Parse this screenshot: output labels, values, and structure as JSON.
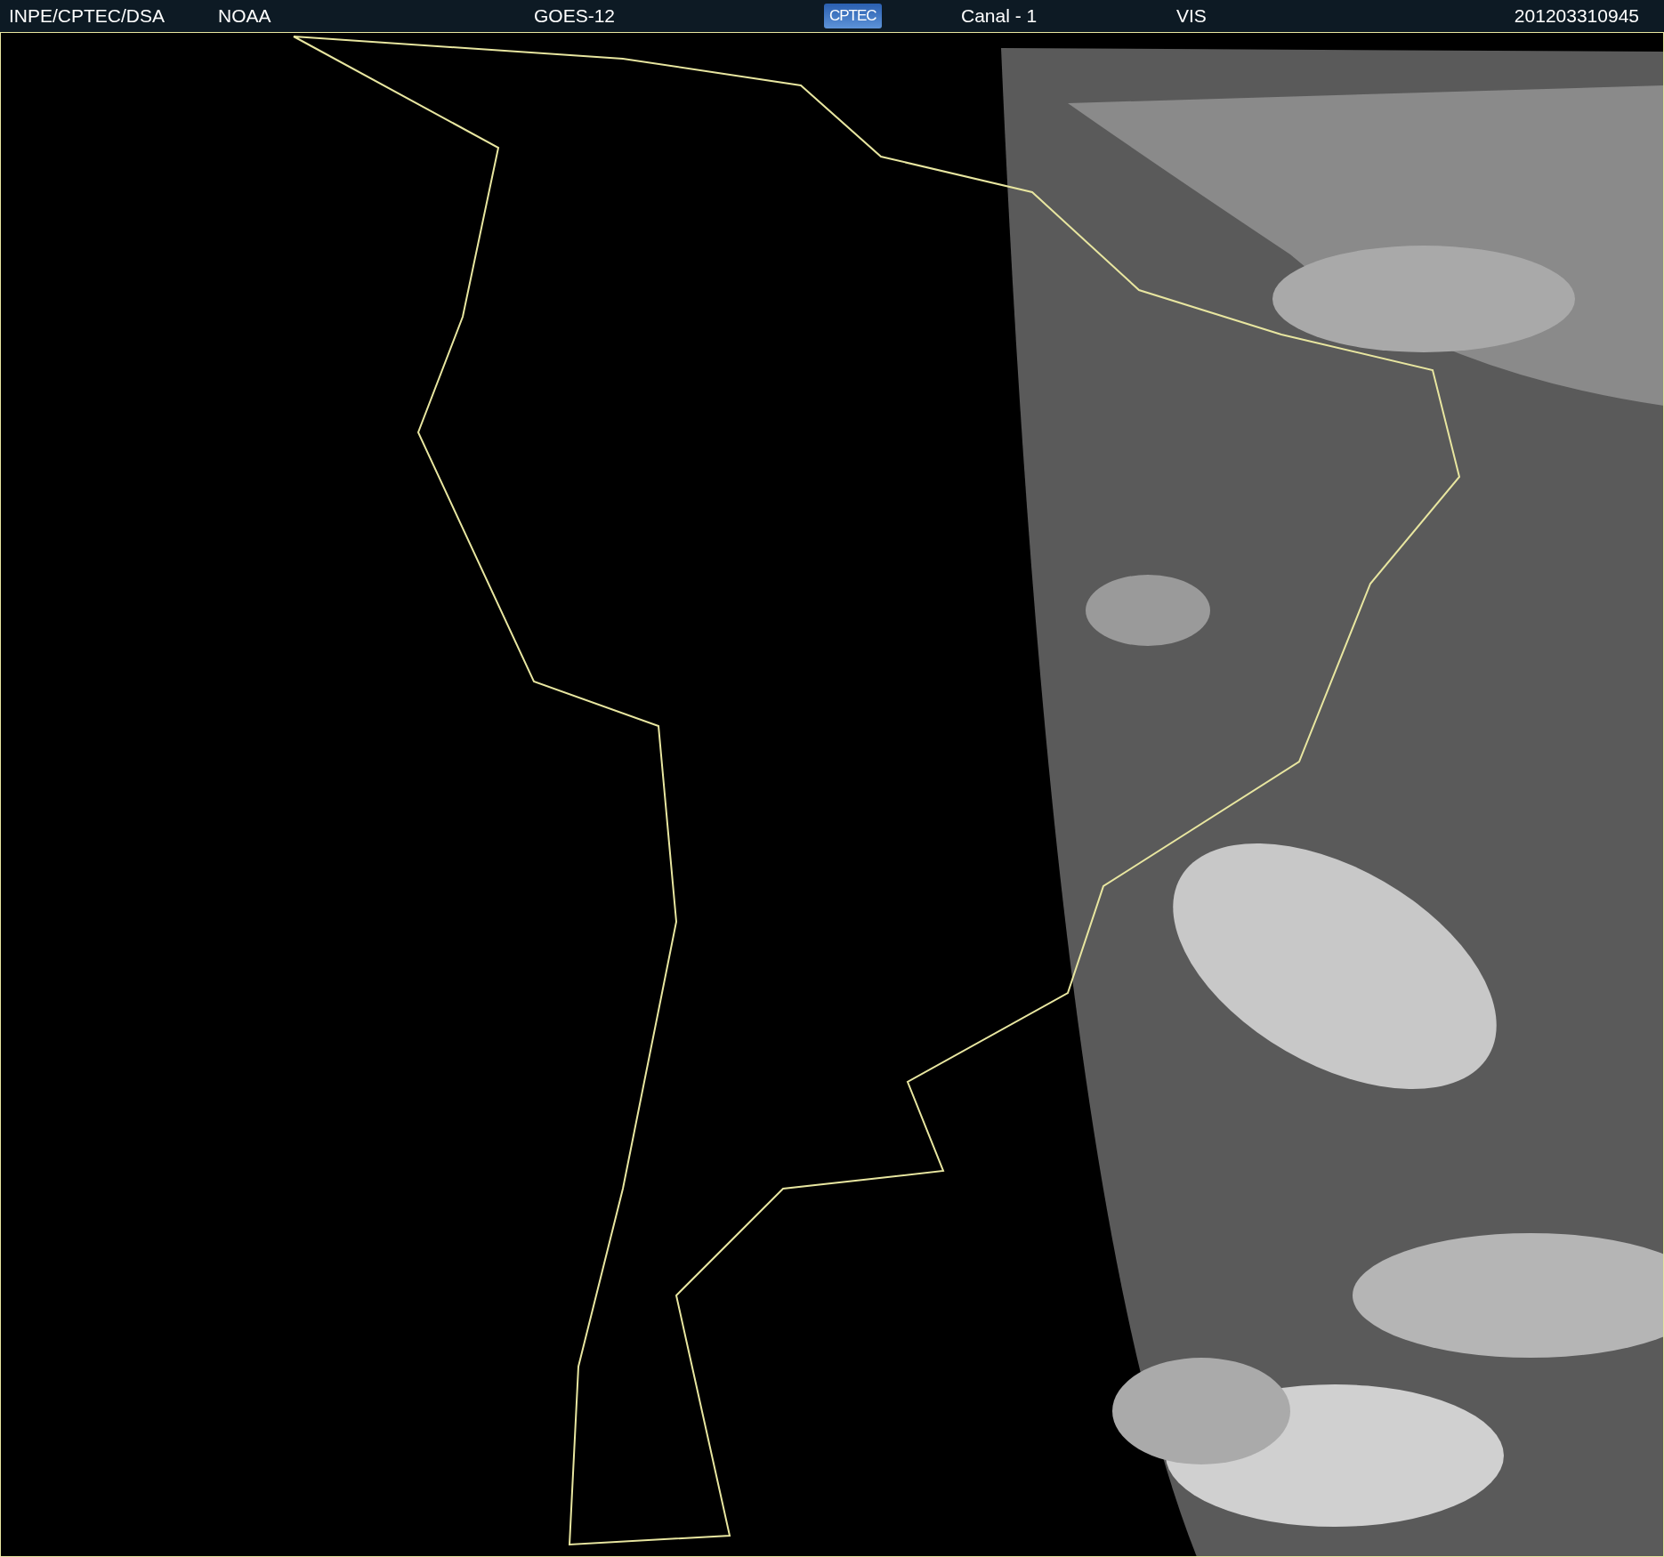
{
  "header": {
    "items": [
      {
        "kind": "text",
        "text": "INPE/CPTEC/DSA"
      },
      {
        "kind": "text",
        "text": "NOAA"
      },
      {
        "kind": "text",
        "text": "GOES-12"
      },
      {
        "kind": "logo",
        "text": "CPTEC"
      },
      {
        "kind": "text",
        "text": "Canal - 1"
      },
      {
        "kind": "text",
        "text": "VIS"
      },
      {
        "kind": "text",
        "text": "201203310945"
      }
    ]
  }
}
